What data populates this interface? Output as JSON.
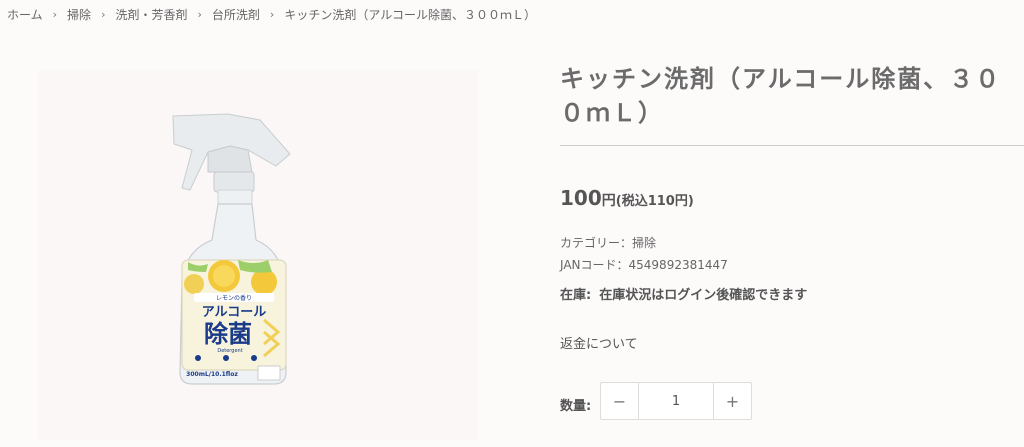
{
  "breadcrumb": {
    "items": [
      "ホーム",
      "掃除",
      "洗剤・芳香剤",
      "台所洗剤",
      "キッチン洗剤（アルコール除菌、３００ｍＬ）"
    ],
    "separator": "›"
  },
  "product": {
    "title": "キッチン洗剤（アルコール除菌、３００ｍＬ）",
    "price": "100",
    "price_unit": "円",
    "price_tax": "(税込110円)",
    "category": "カテゴリー：掃除",
    "jan": "JANコード：4549892381447",
    "stock_label": "在庫:",
    "stock_text": "在庫状況はログイン後確認できます",
    "refund_link": "返金について",
    "quantity_label": "数量:",
    "quantity_value": "1",
    "minus_label": "−",
    "plus_label": "+"
  },
  "image": {
    "label_small": "レモンの香り",
    "label_main_1": "アルコール",
    "label_main_2": "除菌",
    "label_sub": "Detergent",
    "label_volume": "300mL/10.1floz"
  }
}
